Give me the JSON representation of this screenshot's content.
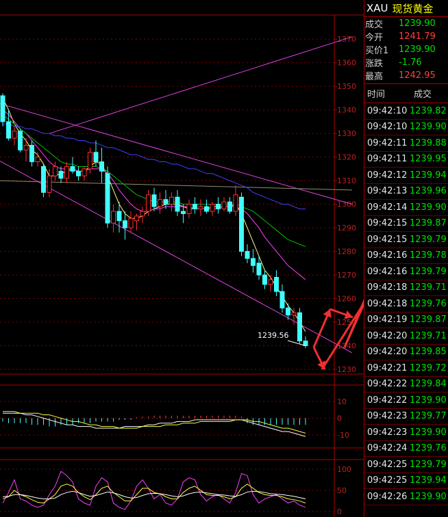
{
  "header": {
    "symbol": "XAU",
    "name": "现货黄金"
  },
  "quote": [
    {
      "label": "成交",
      "value": "1239.90",
      "color": "dn"
    },
    {
      "label": "今开",
      "value": "1241.79",
      "color": "up"
    },
    {
      "label": "买价1",
      "value": "1239.90",
      "color": "dn"
    },
    {
      "label": "涨跌",
      "value": "-1.76",
      "color": "dn"
    },
    {
      "label": "最高",
      "value": "1242.95",
      "color": "up"
    }
  ],
  "ticks_header": {
    "time": "时间",
    "price": "成交"
  },
  "ticks": [
    [
      "09:42:10",
      "1239.82"
    ],
    [
      "09:42:10",
      "1239.90"
    ],
    [
      "09:42:11",
      "1239.88"
    ],
    [
      "09:42:11",
      "1239.95"
    ],
    [
      "09:42:12",
      "1239.94"
    ],
    [
      "09:42:13",
      "1239.96"
    ],
    [
      "09:42:14",
      "1239.90"
    ],
    [
      "09:42:15",
      "1239.87"
    ],
    [
      "09:42:15",
      "1239.79"
    ],
    [
      "09:42:16",
      "1239.78"
    ],
    [
      "09:42:16",
      "1239.79"
    ],
    [
      "09:42:18",
      "1239.71"
    ],
    [
      "09:42:18",
      "1239.76"
    ],
    [
      "09:42:19",
      "1239.87"
    ],
    [
      "09:42:20",
      "1239.71"
    ],
    [
      "09:42:20",
      "1239.85"
    ],
    [
      "09:42:21",
      "1239.72"
    ],
    [
      "09:42:22",
      "1239.84"
    ],
    [
      "09:42:22",
      "1239.90"
    ],
    [
      "09:42:23",
      "1239.77"
    ],
    [
      "09:42:23",
      "1239.90"
    ],
    [
      "09:42:24",
      "1239.76"
    ],
    [
      "09:42:25",
      "1239.79"
    ],
    [
      "09:42:25",
      "1239.94"
    ],
    [
      "09:42:26",
      "1239.90"
    ]
  ],
  "chart_data": [
    {
      "type": "candlestick",
      "title": "",
      "ylim": [
        1230,
        1375
      ],
      "y_ticks": [
        "1370",
        "1360",
        "1350",
        "1340",
        "1330",
        "1320",
        "1310",
        "1300",
        "1290",
        "1280",
        "1270",
        "1260",
        "1250",
        "1240",
        "1230"
      ],
      "last_price_label": "1239.56",
      "candles": [
        {
          "o": 1346,
          "h": 1347,
          "l": 1333,
          "c": 1335
        },
        {
          "o": 1335,
          "h": 1340,
          "l": 1327,
          "c": 1328
        },
        {
          "o": 1328,
          "h": 1333,
          "l": 1325,
          "c": 1331
        },
        {
          "o": 1331,
          "h": 1332,
          "l": 1322,
          "c": 1323
        },
        {
          "o": 1323,
          "h": 1328,
          "l": 1318,
          "c": 1325
        },
        {
          "o": 1325,
          "h": 1327,
          "l": 1316,
          "c": 1318
        },
        {
          "o": 1318,
          "h": 1322,
          "l": 1316,
          "c": 1320
        },
        {
          "o": 1316,
          "h": 1317,
          "l": 1303,
          "c": 1305
        },
        {
          "o": 1305,
          "h": 1315,
          "l": 1303,
          "c": 1312
        },
        {
          "o": 1312,
          "h": 1318,
          "l": 1310,
          "c": 1316
        },
        {
          "o": 1314,
          "h": 1316,
          "l": 1309,
          "c": 1311
        },
        {
          "o": 1311,
          "h": 1318,
          "l": 1309,
          "c": 1316
        },
        {
          "o": 1316,
          "h": 1320,
          "l": 1313,
          "c": 1314
        },
        {
          "o": 1314,
          "h": 1316,
          "l": 1310,
          "c": 1312
        },
        {
          "o": 1312,
          "h": 1316,
          "l": 1310,
          "c": 1315
        },
        {
          "o": 1315,
          "h": 1324,
          "l": 1313,
          "c": 1322
        },
        {
          "o": 1322,
          "h": 1327,
          "l": 1316,
          "c": 1318
        },
        {
          "o": 1318,
          "h": 1324,
          "l": 1309,
          "c": 1314
        },
        {
          "o": 1313,
          "h": 1316,
          "l": 1290,
          "c": 1292
        },
        {
          "o": 1292,
          "h": 1300,
          "l": 1288,
          "c": 1297
        },
        {
          "o": 1297,
          "h": 1301,
          "l": 1288,
          "c": 1293
        },
        {
          "o": 1293,
          "h": 1297,
          "l": 1285,
          "c": 1290
        },
        {
          "o": 1290,
          "h": 1297,
          "l": 1288,
          "c": 1294
        },
        {
          "o": 1293,
          "h": 1296,
          "l": 1289,
          "c": 1295
        },
        {
          "o": 1295,
          "h": 1299,
          "l": 1292,
          "c": 1297
        },
        {
          "o": 1297,
          "h": 1306,
          "l": 1295,
          "c": 1304
        },
        {
          "o": 1304,
          "h": 1307,
          "l": 1297,
          "c": 1299
        },
        {
          "o": 1299,
          "h": 1305,
          "l": 1296,
          "c": 1302
        },
        {
          "o": 1302,
          "h": 1306,
          "l": 1298,
          "c": 1300
        },
        {
          "o": 1300,
          "h": 1305,
          "l": 1297,
          "c": 1303
        },
        {
          "o": 1303,
          "h": 1306,
          "l": 1295,
          "c": 1297
        },
        {
          "o": 1297,
          "h": 1300,
          "l": 1292,
          "c": 1296
        },
        {
          "o": 1296,
          "h": 1302,
          "l": 1294,
          "c": 1300
        },
        {
          "o": 1300,
          "h": 1303,
          "l": 1296,
          "c": 1298
        },
        {
          "o": 1298,
          "h": 1302,
          "l": 1295,
          "c": 1299
        },
        {
          "o": 1299,
          "h": 1302,
          "l": 1296,
          "c": 1297
        },
        {
          "o": 1297,
          "h": 1301,
          "l": 1295,
          "c": 1300
        },
        {
          "o": 1300,
          "h": 1303,
          "l": 1296,
          "c": 1298
        },
        {
          "o": 1298,
          "h": 1303,
          "l": 1297,
          "c": 1301
        },
        {
          "o": 1301,
          "h": 1303,
          "l": 1296,
          "c": 1297
        },
        {
          "o": 1297,
          "h": 1308,
          "l": 1295,
          "c": 1304
        },
        {
          "o": 1303,
          "h": 1305,
          "l": 1278,
          "c": 1280
        },
        {
          "o": 1280,
          "h": 1283,
          "l": 1275,
          "c": 1277
        },
        {
          "o": 1277,
          "h": 1281,
          "l": 1271,
          "c": 1274
        },
        {
          "o": 1275,
          "h": 1278,
          "l": 1268,
          "c": 1270
        },
        {
          "o": 1270,
          "h": 1272,
          "l": 1264,
          "c": 1266
        },
        {
          "o": 1266,
          "h": 1270,
          "l": 1263,
          "c": 1268
        },
        {
          "o": 1269,
          "h": 1272,
          "l": 1261,
          "c": 1263
        },
        {
          "o": 1263,
          "h": 1266,
          "l": 1254,
          "c": 1256
        },
        {
          "o": 1256,
          "h": 1258,
          "l": 1251,
          "c": 1253
        },
        {
          "o": 1253,
          "h": 1256,
          "l": 1249,
          "c": 1254
        },
        {
          "o": 1254,
          "h": 1256,
          "l": 1241,
          "c": 1242
        },
        {
          "o": 1242,
          "h": 1244,
          "l": 1239,
          "c": 1240
        }
      ],
      "moving_averages": [
        {
          "color": "#ffff80",
          "values": [
            1345,
            1340,
            1334,
            1330,
            1327,
            1323,
            1321,
            1317,
            1312,
            1312,
            1313,
            1314,
            1315,
            1314,
            1314,
            1316,
            1318,
            1317,
            1312,
            1306,
            1300,
            1296,
            1294,
            1294,
            1295,
            1297,
            1298,
            1299,
            1300,
            1300,
            1300,
            1299,
            1298,
            1298,
            1298,
            1298,
            1299,
            1299,
            1299,
            1299,
            1300,
            1296,
            1290,
            1284,
            1278,
            1272,
            1269,
            1265,
            1261,
            1257,
            1254,
            1250,
            1246
          ]
        },
        {
          "color": "#ff40ff",
          "values": [
            1340,
            1338,
            1335,
            1332,
            1330,
            1327,
            1324,
            1321,
            1318,
            1316,
            1315,
            1315,
            1315,
            1314,
            1314,
            1315,
            1315,
            1315,
            1313,
            1310,
            1306,
            1303,
            1300,
            1298,
            1297,
            1297,
            1298,
            1298,
            1299,
            1299,
            1299,
            1299,
            1299,
            1298,
            1298,
            1298,
            1298,
            1298,
            1299,
            1299,
            1299,
            1298,
            1296,
            1293,
            1290,
            1286,
            1283,
            1280,
            1277,
            1274,
            1272,
            1270,
            1268
          ]
        },
        {
          "color": "#00c000",
          "values": [
            1338,
            1336,
            1334,
            1332,
            1330,
            1328,
            1326,
            1324,
            1322,
            1320,
            1318,
            1317,
            1317,
            1316,
            1316,
            1316,
            1316,
            1315,
            1314,
            1312,
            1310,
            1308,
            1306,
            1304,
            1303,
            1302,
            1301,
            1301,
            1301,
            1301,
            1301,
            1300,
            1300,
            1300,
            1300,
            1300,
            1300,
            1300,
            1300,
            1300,
            1300,
            1299,
            1298,
            1297,
            1295,
            1293,
            1291,
            1289,
            1287,
            1285,
            1284,
            1283,
            1282
          ]
        },
        {
          "color": "#4040ff",
          "values": [
            1334,
            1334,
            1333,
            1333,
            1332,
            1332,
            1331,
            1330,
            1330,
            1329,
            1329,
            1328,
            1328,
            1327,
            1327,
            1326,
            1326,
            1325,
            1324,
            1324,
            1323,
            1322,
            1321,
            1321,
            1320,
            1319,
            1319,
            1318,
            1318,
            1317,
            1317,
            1316,
            1315,
            1315,
            1314,
            1313,
            1313,
            1312,
            1311,
            1310,
            1309,
            1308,
            1307,
            1305,
            1304,
            1303,
            1302,
            1301,
            1300,
            1300,
            1299,
            1298,
            1298
          ]
        }
      ],
      "channel_lines": [
        {
          "color": "#e040e0",
          "from": [
            -1,
            1343
          ],
          "to": [
            60,
            1300
          ]
        },
        {
          "color": "#e040e0",
          "from": [
            -1,
            1319
          ],
          "to": [
            60,
            1237
          ]
        },
        {
          "color": "#e040e0",
          "from": [
            8,
            1330
          ],
          "to": [
            60,
            1371
          ]
        },
        {
          "color": "#909070",
          "from": [
            -1,
            1310
          ],
          "to": [
            60,
            1306
          ]
        }
      ]
    },
    {
      "type": "bar",
      "title": "",
      "ylim": [
        -15,
        15
      ],
      "y_ticks": [
        "10",
        "0",
        "-10"
      ],
      "histogram": [
        -2,
        -3,
        -3,
        -3,
        -3,
        -4,
        -4,
        -4,
        -5,
        -5,
        -4,
        -4,
        -4,
        -3,
        -3,
        -3,
        -2,
        -2,
        -2,
        -2,
        -1,
        -1,
        -1,
        0.5,
        1,
        1,
        1.5,
        1.5,
        1.5,
        1.5,
        1.5,
        1.5,
        1.5,
        1.5,
        1.5,
        1.5,
        1.5,
        1.5,
        1.5,
        1.5,
        1.5,
        1,
        -3,
        -4,
        -4,
        -4,
        -4,
        -4,
        -4,
        -4,
        -4,
        -4,
        -4
      ],
      "lines": [
        {
          "color": "#ffffff",
          "values": [
            3,
            3,
            3,
            3,
            2,
            2,
            1,
            0,
            -1,
            -2,
            -3,
            -4,
            -4,
            -5,
            -5,
            -5,
            -6,
            -6,
            -6,
            -6,
            -6,
            -5,
            -5,
            -5,
            -5,
            -4,
            -4,
            -3,
            -3,
            -3,
            -2,
            -2,
            -2,
            -1,
            -1,
            -1,
            -1,
            -1,
            -1,
            -1,
            -1,
            -1,
            -2,
            -3,
            -4,
            -5,
            -6,
            -7,
            -8,
            -8,
            -9,
            -10,
            -11
          ]
        },
        {
          "color": "#ffff40",
          "values": [
            4,
            4,
            4,
            3,
            3,
            3,
            3,
            2,
            2,
            1,
            0,
            -1,
            -2,
            -2,
            -3,
            -4,
            -4,
            -5,
            -5,
            -5,
            -6,
            -6,
            -6,
            -6,
            -5,
            -5,
            -5,
            -5,
            -4,
            -4,
            -4,
            -3,
            -3,
            -3,
            -2,
            -2,
            -2,
            -2,
            -2,
            -2,
            -1,
            -1,
            -1,
            -2,
            -2,
            -3,
            -4,
            -5,
            -6,
            -6,
            -7,
            -8,
            -9
          ]
        }
      ]
    },
    {
      "type": "line",
      "title": "",
      "ylim": [
        0,
        110
      ],
      "y_ticks": [
        "100",
        "50",
        "0"
      ],
      "series": [
        {
          "color": "#ff40ff",
          "values": [
            20,
            45,
            75,
            30,
            25,
            15,
            10,
            15,
            40,
            60,
            95,
            85,
            70,
            30,
            20,
            15,
            60,
            80,
            70,
            20,
            10,
            5,
            25,
            60,
            75,
            55,
            30,
            40,
            20,
            15,
            30,
            70,
            80,
            75,
            40,
            25,
            35,
            40,
            30,
            20,
            45,
            90,
            85,
            40,
            20,
            30,
            35,
            40,
            30,
            20,
            25,
            15,
            10
          ]
        },
        {
          "color": "#ffff40",
          "values": [
            30,
            35,
            50,
            40,
            35,
            28,
            22,
            20,
            30,
            40,
            60,
            65,
            60,
            45,
            35,
            28,
            40,
            55,
            60,
            45,
            35,
            25,
            25,
            40,
            55,
            55,
            45,
            42,
            35,
            30,
            30,
            45,
            55,
            60,
            50,
            40,
            38,
            38,
            35,
            30,
            35,
            55,
            65,
            55,
            45,
            40,
            38,
            38,
            35,
            30,
            28,
            25,
            20
          ]
        },
        {
          "color": "#ffffff",
          "values": [
            35,
            36,
            40,
            40,
            38,
            35,
            32,
            30,
            30,
            32,
            40,
            45,
            48,
            45,
            40,
            36,
            38,
            42,
            46,
            44,
            40,
            35,
            32,
            33,
            38,
            42,
            43,
            42,
            40,
            37,
            35,
            37,
            42,
            45,
            46,
            44,
            42,
            40,
            39,
            37,
            36,
            40,
            46,
            48,
            47,
            45,
            42,
            41,
            40,
            38,
            36,
            33,
            30
          ]
        }
      ]
    }
  ]
}
